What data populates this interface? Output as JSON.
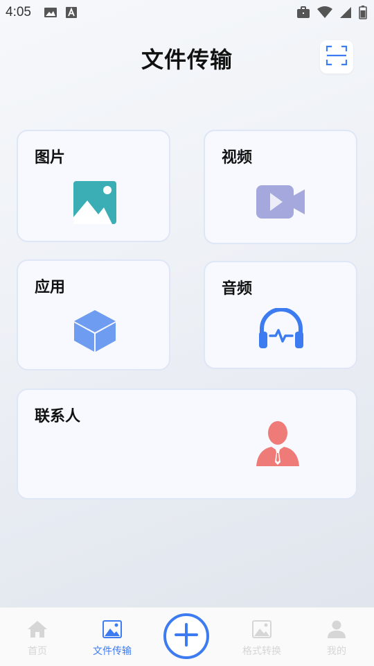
{
  "status_bar": {
    "time": "4:05",
    "left_icons": [
      "image-icon",
      "font-a-icon"
    ],
    "right_icons": [
      "briefcase-icon",
      "wifi-icon",
      "signal-icon",
      "battery-icon"
    ]
  },
  "header": {
    "title": "文件传输",
    "scan_icon": "scan-icon"
  },
  "categories": [
    {
      "label": "图片",
      "icon": "picture-icon",
      "color": "#3aaeb4"
    },
    {
      "label": "视频",
      "icon": "video-camera-icon",
      "color": "#a4a8dc"
    },
    {
      "label": "应用",
      "icon": "cube-icon",
      "color": "#6e9cf0"
    },
    {
      "label": "音频",
      "icon": "headphones-icon",
      "color": "#3d7cf0"
    },
    {
      "label": "联系人",
      "icon": "person-icon",
      "color": "#ee7b78"
    }
  ],
  "tabbar": {
    "items": [
      {
        "label": "首页",
        "icon": "home-icon",
        "active": false
      },
      {
        "label": "文件传输",
        "icon": "image-icon",
        "active": true
      },
      {
        "label": "",
        "icon": "plus-icon",
        "active": false
      },
      {
        "label": "格式转换",
        "icon": "image-icon",
        "active": false
      },
      {
        "label": "我的",
        "icon": "user-icon",
        "active": false
      }
    ]
  },
  "colors": {
    "accent": "#3d7cf0",
    "inactive_tab": "#d6d6d6",
    "card_bg": "#f7f9fe",
    "card_border": "#dfe6f5"
  }
}
